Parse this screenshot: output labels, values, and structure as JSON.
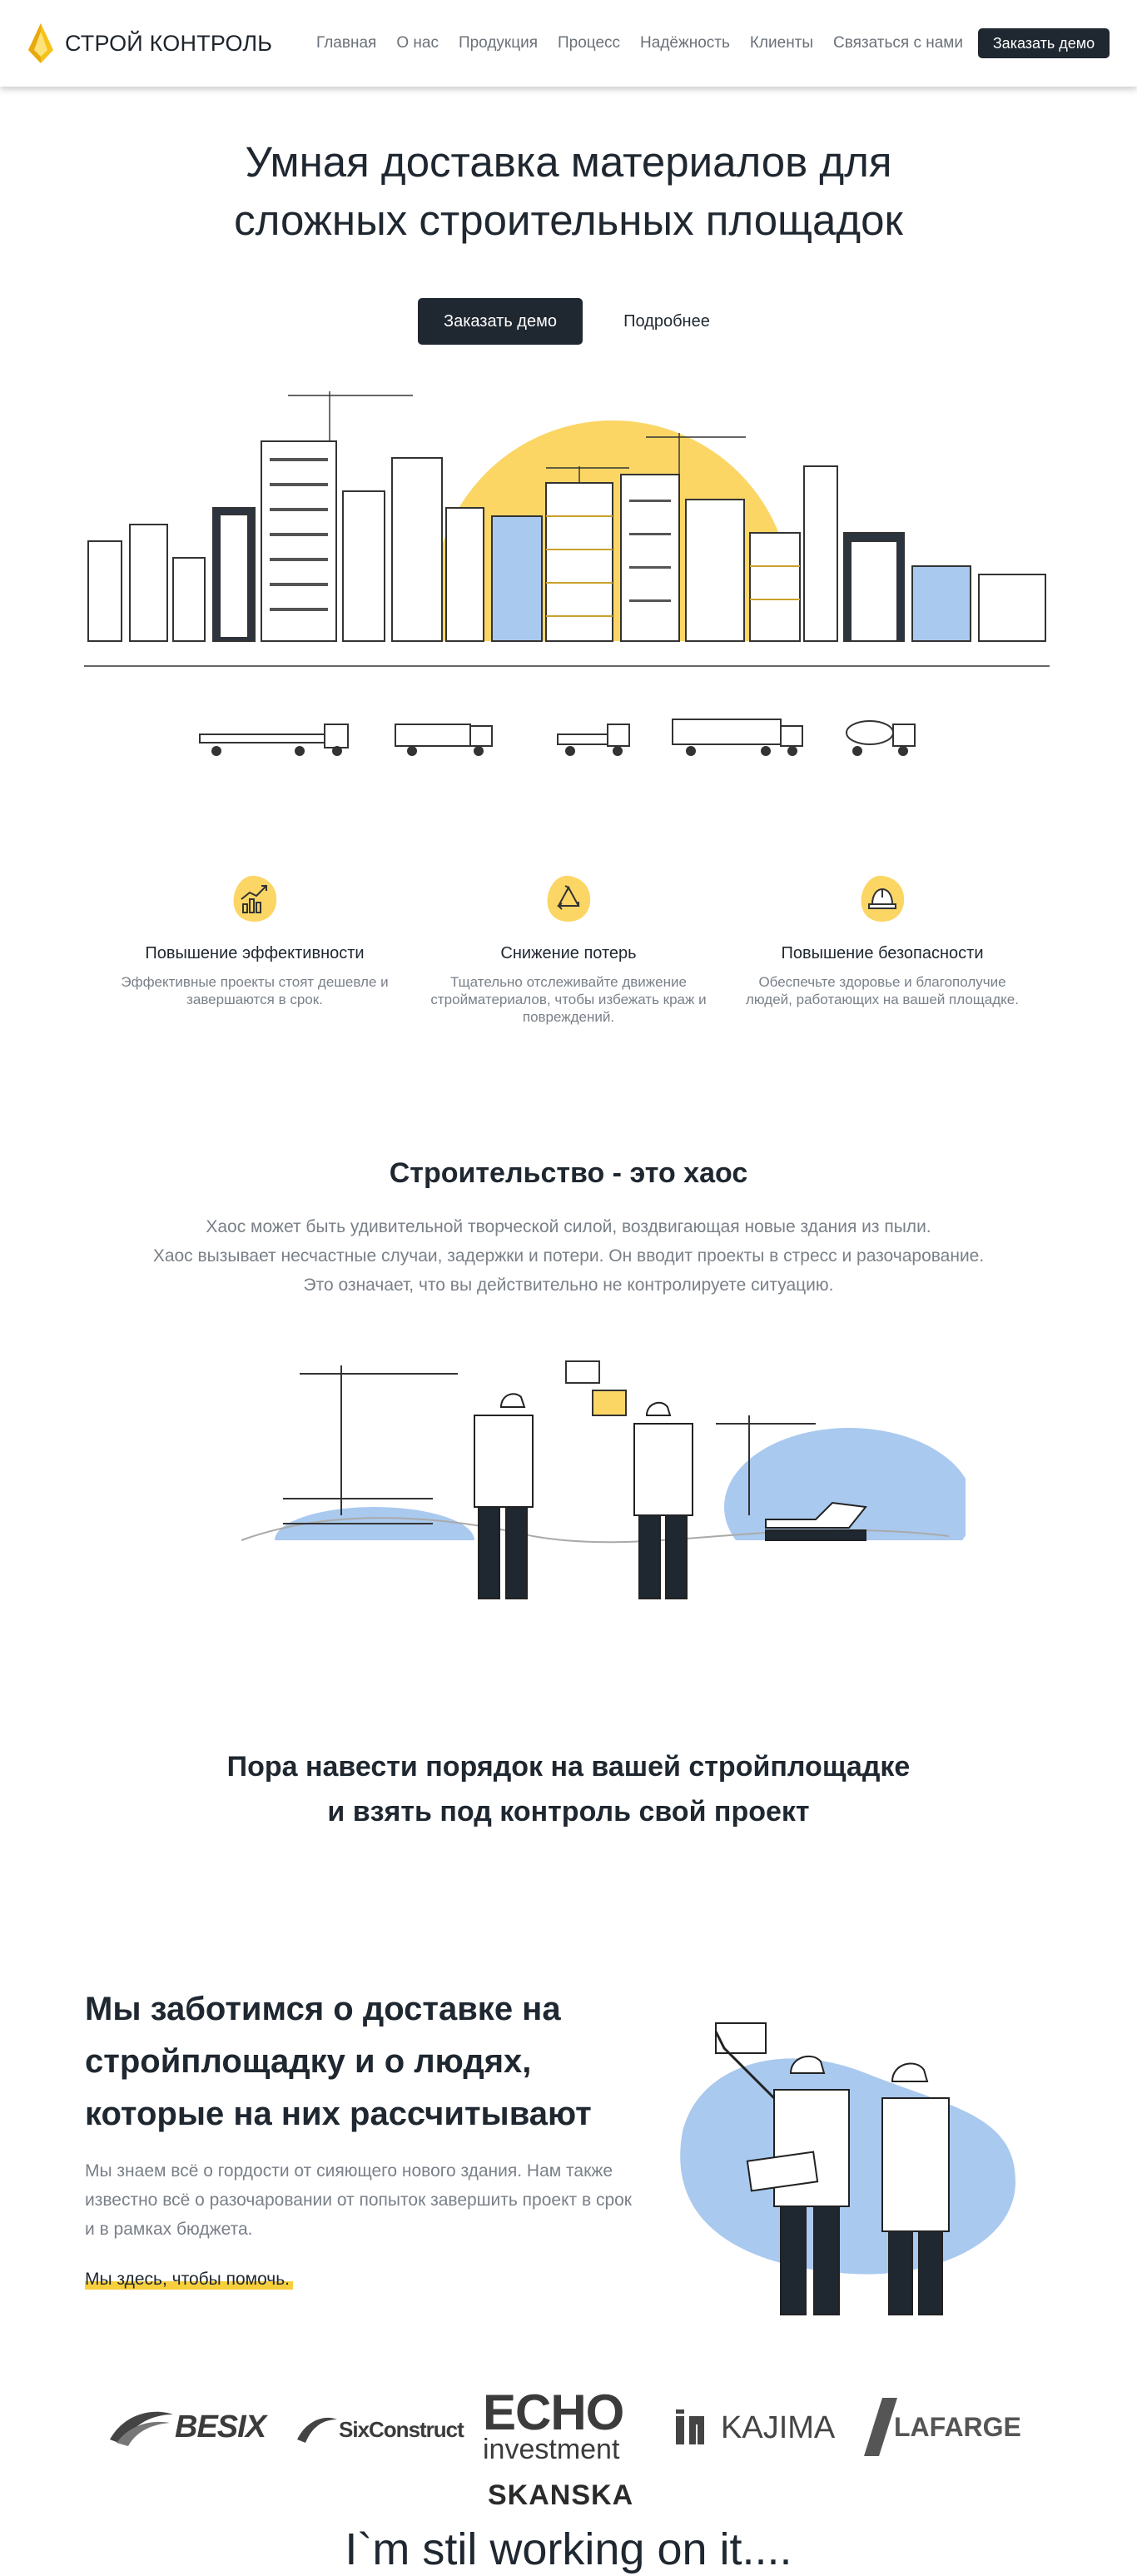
{
  "nav": {
    "brand": "СТРОЙ КОНТРОЛЬ",
    "items": [
      "Главная",
      "О нас",
      "Продукция",
      "Процесс",
      "Надёжность",
      "Клиенты",
      "Связаться с нами"
    ],
    "cta": "Заказать демо"
  },
  "hero": {
    "title_line1": "Умная доставка материалов для",
    "title_line2": "сложных строительных площадок",
    "primary_button": "Заказать демо",
    "secondary_button": "Подробнее"
  },
  "features": [
    {
      "icon": "chart-growth-icon",
      "title": "Повышение эффективности",
      "text": "Эффективные проекты стоят дешевле и завершаются в срок."
    },
    {
      "icon": "recycle-icon",
      "title": "Снижение потерь",
      "text": "Тщательно отслеживайте движение стройматериалов, чтобы избежать краж и повреждений."
    },
    {
      "icon": "hard-hat-icon",
      "title": "Повышение безопасности",
      "text": "Обеспечьте здоровье и благополучие людей, работающих на вашей площадке."
    }
  ],
  "chaos": {
    "title": "Строительство - это хаос",
    "line1": "Хаос может быть удивительной творческой силой, воздвигающая новые здания из пыли.",
    "line2": "Хаос вызывает несчастные случаи, задержки и потери. Он вводит проекты в стресс и разочарование.",
    "line3": "Это означает, что вы действительно не контролируете ситуацию."
  },
  "order": {
    "line1": "Пора навести порядок на вашей стройплощадке",
    "line2": "и взять под контроль свой проект"
  },
  "care": {
    "title_line1": "Мы заботимся о доставке на",
    "title_line2": "стройплощадку и о людях,",
    "title_line3": "которые на них рассчитывают",
    "text": "Мы знаем всё о гордости от сияющего нового здания. Нам также известно всё о разочаровании от попыток завершить проект в срок и в рамках бюджета.",
    "highlight": "Мы здесь, чтобы помочь."
  },
  "clients": {
    "besix": "BESIX",
    "sixconstruct": "SixConstruct",
    "echo_top": "ECHO",
    "echo_bottom": "investment",
    "kajima": "KAJIMA",
    "lafarge": "LAFARGE",
    "skanska": "SKANSKA"
  },
  "footer_note": "I`m stil working on it....",
  "colors": {
    "accent": "#f7cf3c",
    "dark": "#1f2730",
    "muted": "#7a8088",
    "sky_blue": "#a9c9ef"
  }
}
